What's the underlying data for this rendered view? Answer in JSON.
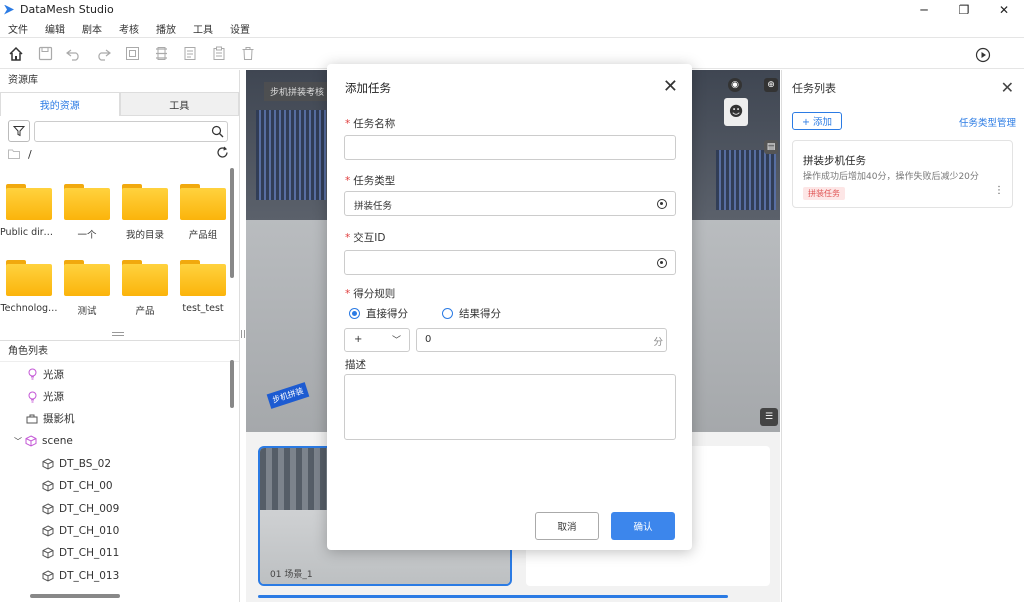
{
  "window": {
    "title": "DataMesh Studio",
    "controls": [
      "─",
      "❐",
      "✕"
    ]
  },
  "menu": [
    "文件",
    "编辑",
    "剧本",
    "考核",
    "播放",
    "工具",
    "设置"
  ],
  "left": {
    "header": "资源库",
    "tabs": [
      "我的资源",
      "工具"
    ],
    "path": "/",
    "folders": [
      "Public direc…",
      "一个",
      "我的目录",
      "产品组",
      "Technolog…",
      "测试",
      "产品",
      "test_test"
    ],
    "roles_header": "角色列表",
    "tree": [
      "光源",
      "光源",
      "摄影机",
      "scene",
      "DT_BS_02",
      "DT_CH_00",
      "DT_CH_009",
      "DT_CH_010",
      "DT_CH_011",
      "DT_CH_013"
    ]
  },
  "viewport": {
    "label": "步机拼装考核",
    "tag": "步机拼装"
  },
  "scene": {
    "label": "01 场景_1"
  },
  "right": {
    "title": "任务列表",
    "add_label": "+ 添加",
    "manage_label": "任务类型管理",
    "task": {
      "name": "拼装步机任务",
      "desc": "操作成功后增加40分，操作失败后减少20分",
      "badge": "拼装任务"
    }
  },
  "modal": {
    "title": "添加任务",
    "task_name_label": "任务名称",
    "task_name_value": "",
    "task_type_label": "任务类型",
    "task_type_value": "拼装任务",
    "interact_label": "交互ID",
    "interact_value": "",
    "score_label": "得分规则",
    "radio_direct": "直接得分",
    "radio_result": "结果得分",
    "op_value": "+",
    "score_value": "0",
    "score_unit": "分",
    "desc_label": "描述",
    "cancel": "取消",
    "confirm": "确认"
  },
  "colors": {
    "accent": "#2b7be4",
    "required": "#e03c3c",
    "folder": "#fbb40b"
  }
}
